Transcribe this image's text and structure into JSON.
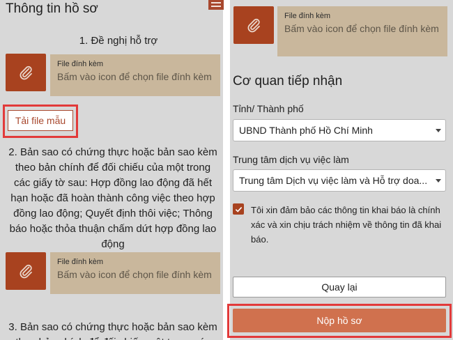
{
  "left": {
    "title": "Thông tin hồ sơ",
    "sections": [
      {
        "heading": "1. Đề nghị hỗ trợ"
      },
      {
        "heading": "2. Bản sao có chứng thực hoặc bản sao kèm theo bản chính để đối chiếu của một trong các giấy tờ sau: Hợp đồng lao động đã hết hạn hoặc đã hoàn thành công việc theo hợp đồng lao động; Quyết định thôi việc; Thông báo hoặc thỏa thuận chấm dứt hợp đồng lao động"
      },
      {
        "heading": "3. Bản sao có chứng thực hoặc bản sao kèm theo bản chính để đối chiếu một trong các"
      }
    ],
    "attachments": [
      {
        "label": "File đính kèm",
        "hint": "Bấm vào icon để chọn file đính kèm"
      },
      {
        "label": "File đính kèm",
        "hint": "Bấm vào icon để chọn file đính kèm"
      }
    ],
    "template_button": "Tải file mẫu"
  },
  "right": {
    "attachment": {
      "label": "File đính kèm",
      "hint": "Bấm vào icon để chọn file đính kèm"
    },
    "agency_title": "Cơ quan tiếp nhận",
    "province_label": "Tỉnh/ Thành phố",
    "province_value": "UBND Thành phố Hồ Chí Minh",
    "center_label": "Trung tâm dịch vụ việc làm",
    "center_value": "Trung tâm Dịch vụ việc làm và Hỗ trợ doa...",
    "agree_checked": true,
    "agree_text": "Tôi xin đảm bảo các thông tin khai báo là chính xác và xin chịu trách nhiệm về thông tin đã khai báo.",
    "back_button": "Quay lại",
    "submit_button": "Nộp hồ sơ"
  },
  "icons": {
    "attach": "paperclip-icon",
    "menu": "hamburger-menu-icon",
    "check": "checkmark-icon",
    "caret": "chevron-down-icon"
  },
  "colors": {
    "accent": "#a8421f",
    "submit": "#d0714e",
    "attach_box": "#c9b79c",
    "highlight": "#e23a3a",
    "panel_bg": "#d8d8d8"
  }
}
